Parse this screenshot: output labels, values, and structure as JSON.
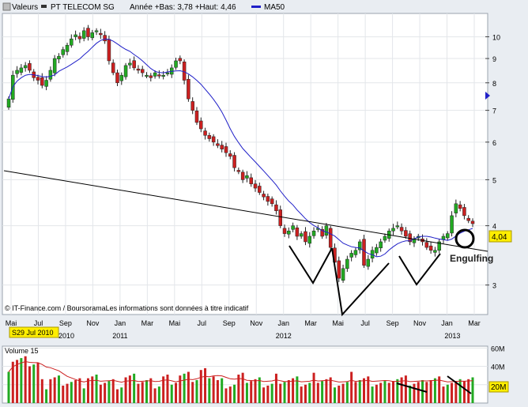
{
  "header": {
    "series_label": "Valeurs",
    "instrument": "PT TELECOM SG",
    "range_text": "Année +Bas: 3,78 +Haut: 4,46",
    "ma_label": "MA50",
    "ma_color": "#2020c8"
  },
  "footer": {
    "source": "© IT-Finance.com / BoursoramaLes informations sont données à titre indicatif",
    "date_badge": "S29 Jul 2010"
  },
  "price_badge": "4,04",
  "volume_badge": "20M",
  "annotation": {
    "label": "Engulfing"
  },
  "colors": {
    "up": "#22aa22",
    "down": "#cc2020",
    "ma": "#2020c8",
    "volume_ma": "#cc2020",
    "badge": "#ffee00"
  },
  "chart_data": {
    "type": "candlestick",
    "title": "PT TELECOM SG",
    "x_tick_labels": [
      "Mai",
      "Jul",
      "Sep",
      "Nov",
      "Jan",
      "Mar",
      "Mai",
      "Jul",
      "Sep",
      "Nov",
      "Jan",
      "Mar",
      "Mai",
      "Jul",
      "Sep",
      "Nov",
      "Jan",
      "Mar"
    ],
    "x_year_labels": [
      "2010",
      "2011",
      "2012",
      "2013"
    ],
    "y_ticks": [
      3,
      4,
      5,
      6,
      7,
      8,
      9,
      10
    ],
    "y_scale": "log",
    "ylim": [
      2.6,
      11.2
    ],
    "last_value": 4.04,
    "moving_average_label": "MA50",
    "weekly_close": [
      7.4,
      8.3,
      8.5,
      8.6,
      8.7,
      8.5,
      8.2,
      8.1,
      7.9,
      8.1,
      8.5,
      9.0,
      9.1,
      9.4,
      9.6,
      9.9,
      10.1,
      9.9,
      10.3,
      10.0,
      10.2,
      10.3,
      10.1,
      9.8,
      8.9,
      8.4,
      8.0,
      8.3,
      8.7,
      8.8,
      8.6,
      8.5,
      8.4,
      8.3,
      8.2,
      8.4,
      8.3,
      8.3,
      8.4,
      8.6,
      8.9,
      8.9,
      8.1,
      7.4,
      7.0,
      6.6,
      6.4,
      6.2,
      6.1,
      6.0,
      5.9,
      5.8,
      5.7,
      5.6,
      5.3,
      5.2,
      5.0,
      5.1,
      4.9,
      4.8,
      4.7,
      4.6,
      4.5,
      4.45,
      4.3,
      4.0,
      3.85,
      3.9,
      4.0,
      3.8,
      3.85,
      3.7,
      3.8,
      3.9,
      3.95,
      3.8,
      4.0,
      3.6,
      3.35,
      3.1,
      3.25,
      3.4,
      3.5,
      3.55,
      3.7,
      3.3,
      3.4,
      3.55,
      3.6,
      3.7,
      3.8,
      3.9,
      3.95,
      4.0,
      3.9,
      3.8,
      3.7,
      3.75,
      3.8,
      3.7,
      3.6,
      3.55,
      3.55,
      3.7,
      3.8,
      3.85,
      4.2,
      4.45,
      4.35,
      4.2,
      4.1,
      4.04
    ],
    "volume_ticks": [
      "20M",
      "40M",
      "60M"
    ],
    "volume_title": "Volume 15"
  }
}
